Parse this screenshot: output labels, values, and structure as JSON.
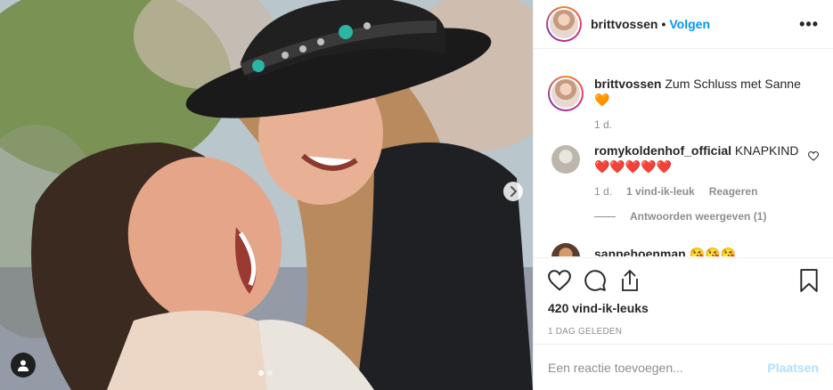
{
  "post": {
    "username": "brittvossen",
    "follow_label": "Volgen",
    "separator": "•",
    "more_label": "•••"
  },
  "caption": {
    "username": "brittvossen",
    "text": "Zum Schluss met Sanne",
    "emoji": "🧡",
    "time": "1 d."
  },
  "comments": [
    {
      "username": "romykoldenhof_official",
      "text": "KNAPKIND",
      "emoji": "❤️❤️❤️❤️❤️",
      "time": "1 d.",
      "likes": "1 vind-ik-leuk",
      "reply_label": "Reageren",
      "view_replies": "Antwoorden weergeven (1)"
    },
    {
      "username": "sannehoenman",
      "text": "😘😘😘"
    }
  ],
  "actions": {
    "likes_count": "420 vind-ik-leuks",
    "posted_time": "1 DAG GELEDEN"
  },
  "add_comment": {
    "placeholder": "Een reactie toevoegen...",
    "post_label": "Plaatsen"
  },
  "carousel": {
    "slides": 2,
    "active": 1
  },
  "colors": {
    "link_blue": "#0095f6",
    "post_disabled": "#b2dffc",
    "secondary_text": "#8e8e8e",
    "heart_red": "#ed4956"
  }
}
